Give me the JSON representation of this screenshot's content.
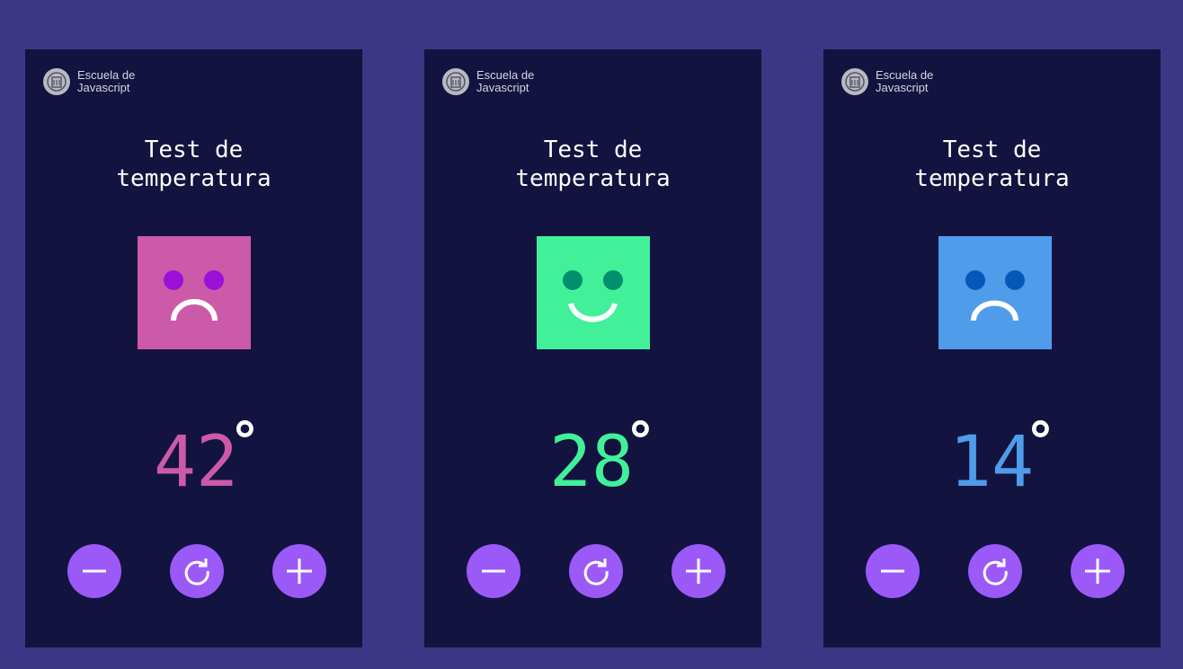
{
  "brand": {
    "line1": "Escuela de",
    "line2": "Javascript"
  },
  "colors": {
    "background": "#3b3784",
    "panel": "#131340",
    "button": "#9b59f8",
    "degree": "#ffffff"
  },
  "panels": [
    {
      "title_line1": "Test de",
      "title_line2": "temperatura",
      "temperature": "42",
      "degree_symbol": "°",
      "mood": "sad",
      "face_color": "#cb5aa9",
      "eye_color": "#9b10d8",
      "temp_color": "#cb5aa9",
      "buttons": {
        "decrease_icon": "minus-icon",
        "reset_icon": "refresh-icon",
        "increase_icon": "plus-icon"
      }
    },
    {
      "title_line1": "Test de",
      "title_line2": "temperatura",
      "temperature": "28",
      "degree_symbol": "°",
      "mood": "happy",
      "face_color": "#42f09a",
      "eye_color": "#008f6c",
      "temp_color": "#42f09a",
      "buttons": {
        "decrease_icon": "minus-icon",
        "reset_icon": "refresh-icon",
        "increase_icon": "plus-icon"
      }
    },
    {
      "title_line1": "Test de",
      "title_line2": "temperatura",
      "temperature": "14",
      "degree_symbol": "°",
      "mood": "sad",
      "face_color": "#4f9cea",
      "eye_color": "#0657b9",
      "temp_color": "#4f9cea",
      "buttons": {
        "decrease_icon": "minus-icon",
        "reset_icon": "refresh-icon",
        "increase_icon": "plus-icon"
      }
    }
  ]
}
